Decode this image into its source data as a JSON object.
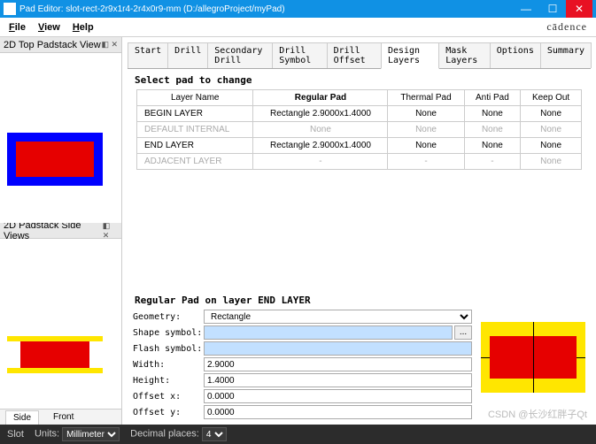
{
  "titlebar": {
    "title": "Pad Editor: slot-rect-2r9x1r4-2r4x0r9-mm   (D:/allegroProject/myPad)"
  },
  "menu": {
    "file": "File",
    "view": "View",
    "help": "Help",
    "brand": "cādence"
  },
  "leftPanels": {
    "top": "2D Top Padstack View",
    "side": "2D Padstack Side Views"
  },
  "tabs": [
    "Start",
    "Drill",
    "Secondary Drill",
    "Drill Symbol",
    "Drill Offset",
    "Design Layers",
    "Mask Layers",
    "Options",
    "Summary"
  ],
  "activeTab": "Design Layers",
  "sectionTitle": "Select pad to change",
  "table": {
    "headers": [
      "Layer Name",
      "Regular Pad",
      "Thermal Pad",
      "Anti Pad",
      "Keep Out"
    ],
    "rows": [
      {
        "name": "BEGIN LAYER",
        "reg": "Rectangle 2.9000x1.4000",
        "th": "None",
        "anti": "None",
        "ko": "None",
        "gray": false
      },
      {
        "name": "DEFAULT INTERNAL",
        "reg": "None",
        "th": "None",
        "anti": "None",
        "ko": "None",
        "gray": true
      },
      {
        "name": "END LAYER",
        "reg": "Rectangle 2.9000x1.4000",
        "th": "None",
        "anti": "None",
        "ko": "None",
        "gray": false
      },
      {
        "name": "ADJACENT LAYER",
        "reg": "-",
        "th": "-",
        "anti": "-",
        "ko": "None",
        "gray": true
      }
    ]
  },
  "lowerTitle": "Regular Pad on layer END LAYER",
  "form": {
    "geometry": {
      "label": "Geometry:",
      "value": "Rectangle"
    },
    "shape": {
      "label": "Shape symbol:",
      "value": ""
    },
    "flash": {
      "label": "Flash symbol:",
      "value": ""
    },
    "width": {
      "label": "Width:",
      "value": "2.9000"
    },
    "height": {
      "label": "Height:",
      "value": "1.4000"
    },
    "ox": {
      "label": "Offset x:",
      "value": "0.0000"
    },
    "oy": {
      "label": "Offset y:",
      "value": "0.0000"
    }
  },
  "sidefront": {
    "side": "Side",
    "front": "Front"
  },
  "status": {
    "slot": "Slot",
    "unitsLabel": "Units:",
    "units": "Millimeter",
    "decLabel": "Decimal places:",
    "dec": "4"
  },
  "watermark": "CSDN @长沙红胖子Qt"
}
